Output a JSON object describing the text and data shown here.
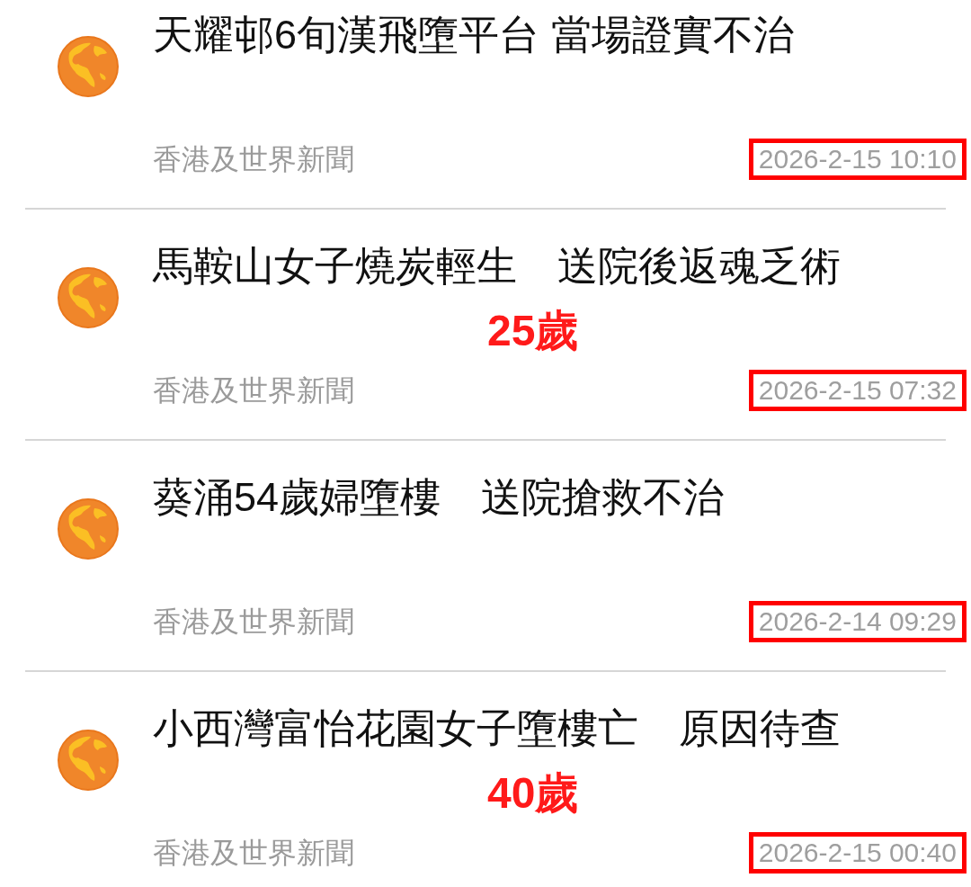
{
  "news_items": [
    {
      "title": "天耀邨6旬漢飛墮平台 當場證實不治",
      "source": "香港及世界新聞",
      "time": "2026-2-15 10:10",
      "time_boxed": true
    },
    {
      "title": "馬鞍山女子燒炭輕生　送院後返魂乏術",
      "annotation": "25歲",
      "source": "香港及世界新聞",
      "time": "2026-2-15 07:32",
      "time_boxed": true
    },
    {
      "title": "葵涌54歲婦墮樓　送院搶救不治",
      "source": "香港及世界新聞",
      "time": "2026-2-14 09:29",
      "time_boxed": true
    },
    {
      "title": "小西灣富怡花園女子墮樓亡　原因待查",
      "annotation": "40歲",
      "source": "香港及世界新聞",
      "time": "2026-2-15 00:40",
      "time_boxed": true
    }
  ]
}
